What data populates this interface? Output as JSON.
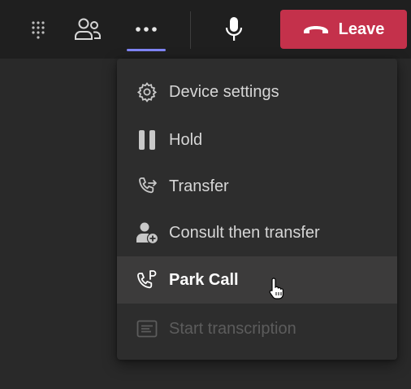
{
  "toolbar": {
    "dialpad_icon": "dialpad-icon",
    "people_icon": "people-icon",
    "more_icon": "more-options-icon",
    "mic_icon": "microphone-icon",
    "leave_label": "Leave",
    "leave_icon": "hang-up-icon",
    "leave_color": "#c4314b",
    "accent_color": "#7f85f5"
  },
  "menu": {
    "items": [
      {
        "label": "Device settings",
        "icon": "gear-icon",
        "state": "normal"
      },
      {
        "label": "Hold",
        "icon": "pause-icon",
        "state": "normal"
      },
      {
        "label": "Transfer",
        "icon": "transfer-icon",
        "state": "normal"
      },
      {
        "label": "Consult then transfer",
        "icon": "person-add-icon",
        "state": "normal"
      },
      {
        "label": "Park Call",
        "icon": "park-call-icon",
        "state": "hover"
      },
      {
        "label": "Start transcription",
        "icon": "transcript-icon",
        "state": "disabled"
      }
    ]
  }
}
